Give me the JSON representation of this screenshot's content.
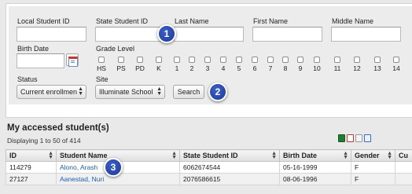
{
  "search_form": {
    "local_student_id_label": "Local Student ID",
    "state_student_id_label": "State Student ID",
    "last_name_label": "Last Name",
    "first_name_label": "First Name",
    "middle_name_label": "Middle Name",
    "birth_date_label": "Birth Date",
    "grade_level_label": "Grade Level",
    "grade_levels": [
      "HS",
      "PS",
      "PD",
      "K",
      "1",
      "2",
      "3",
      "4",
      "5",
      "6",
      "7",
      "8",
      "9",
      "10",
      "11",
      "12",
      "13",
      "14"
    ],
    "status_label": "Status",
    "status_value": "Current enrollmen",
    "site_label": "Site",
    "site_value": "Illuminate School",
    "search_button": "Search"
  },
  "callouts": [
    "1",
    "2",
    "3"
  ],
  "results": {
    "title": "My accessed student(s)",
    "displaying": "Displaying 1 to 50 of 414",
    "export_icons": [
      "excel-icon",
      "pdf-icon",
      "csv-icon",
      "print-icon"
    ],
    "columns": [
      "ID",
      "Student Name",
      "State Student ID",
      "Birth Date",
      "Gender",
      "Cu"
    ],
    "rows": [
      {
        "id": "114279",
        "name": "Alono, Arash",
        "state_id": "6062674544",
        "birth_date": "05-16-1999",
        "gender": "F"
      },
      {
        "id": "27127",
        "name": "Aanestad, Nuri",
        "state_id": "2076586615",
        "birth_date": "08-06-1996",
        "gender": "F"
      }
    ]
  },
  "colors": {
    "callout": "#1f3fa3",
    "link": "#1f5fb0",
    "panel_shade": "#ececec"
  }
}
